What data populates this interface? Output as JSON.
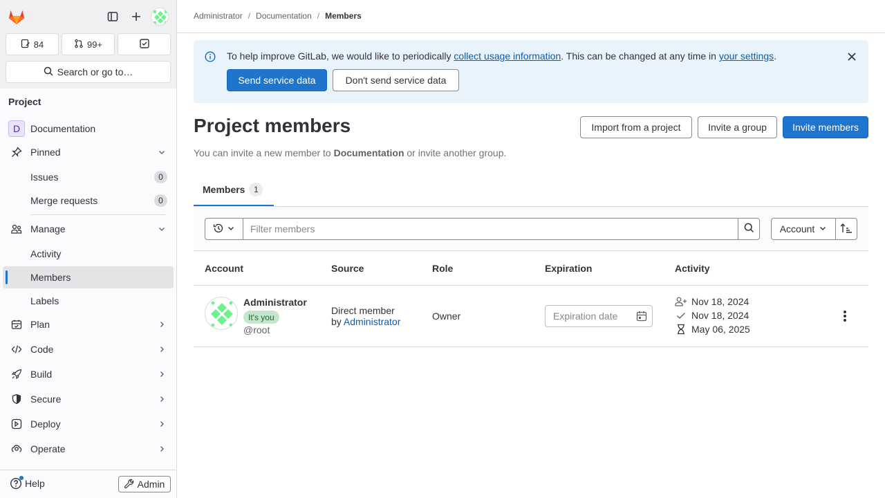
{
  "sidebar": {
    "counters": {
      "issues": "84",
      "merge_requests": "99+"
    },
    "search_label": "Search or go to…",
    "section_heading": "Project",
    "project": {
      "initial": "D",
      "name": "Documentation"
    },
    "pinned": {
      "label": "Pinned",
      "items": [
        {
          "label": "Issues",
          "count": "0"
        },
        {
          "label": "Merge requests",
          "count": "0"
        }
      ]
    },
    "manage": {
      "label": "Manage",
      "items": [
        {
          "label": "Activity"
        },
        {
          "label": "Members"
        },
        {
          "label": "Labels"
        }
      ]
    },
    "groups": [
      {
        "label": "Plan"
      },
      {
        "label": "Code"
      },
      {
        "label": "Build"
      },
      {
        "label": "Secure"
      },
      {
        "label": "Deploy"
      },
      {
        "label": "Operate"
      }
    ],
    "help_label": "Help",
    "admin_label": "Admin"
  },
  "breadcrumbs": [
    "Administrator",
    "Documentation",
    "Members"
  ],
  "banner": {
    "text_before": "To help improve GitLab, we would like to periodically ",
    "link1": "collect usage information",
    "text_middle": ". This can be changed at any time in ",
    "link2": "your settings",
    "text_after": ".",
    "primary_button": "Send service data",
    "secondary_button": "Don't send service data"
  },
  "page": {
    "title": "Project members",
    "subtitle_before": "You can invite a new member to ",
    "subtitle_project": "Documentation",
    "subtitle_after": " or invite another group.",
    "import_button": "Import from a project",
    "invite_group_button": "Invite a group",
    "invite_members_button": "Invite members"
  },
  "tabs": [
    {
      "label": "Members",
      "count": "1"
    }
  ],
  "filter": {
    "placeholder": "Filter members",
    "sort_label": "Account"
  },
  "table": {
    "headers": [
      "Account",
      "Source",
      "Role",
      "Expiration",
      "Activity"
    ],
    "rows": [
      {
        "name": "Administrator",
        "badge": "It's you",
        "username": "@root",
        "source_line1": "Direct member",
        "source_by": "by ",
        "source_link": "Administrator",
        "role": "Owner",
        "expiration_placeholder": "Expiration date",
        "activity": {
          "user_created": "Nov 18, 2024",
          "access_granted": "Nov 18, 2024",
          "last_activity": "May 06, 2025"
        }
      }
    ]
  },
  "colors": {
    "brand_blue": "#1f75cb",
    "banner_bg": "#e9f3fc",
    "link": "#0b5cad",
    "badge_green": "#c3e6cd"
  }
}
